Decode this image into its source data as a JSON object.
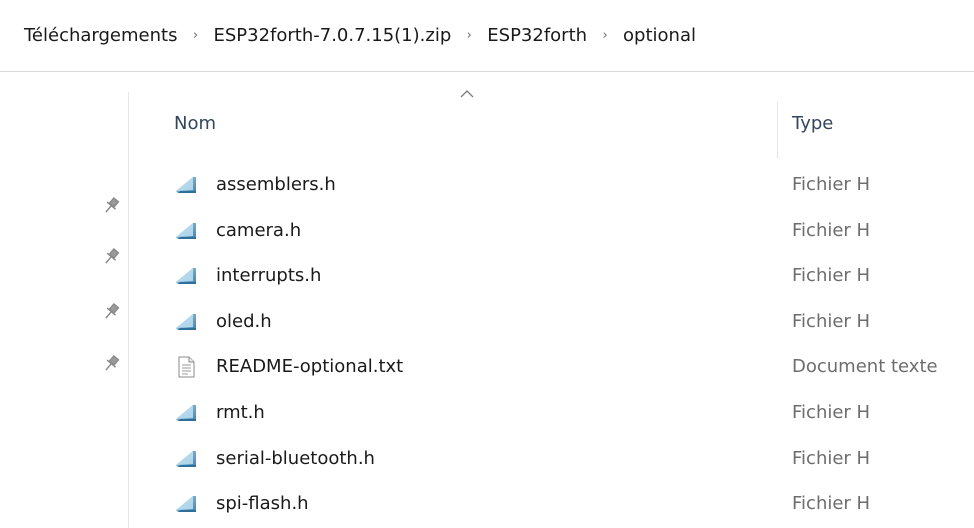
{
  "breadcrumb": [
    {
      "label": "Téléchargements"
    },
    {
      "label": "ESP32forth-7.0.7.15(1).zip"
    },
    {
      "label": "ESP32forth"
    },
    {
      "label": "optional"
    }
  ],
  "breadcrumb_separator": "›",
  "columns": {
    "name": "Nom",
    "type": "Type"
  },
  "sort": {
    "column": "name",
    "direction": "ascending"
  },
  "files": [
    {
      "name": "assemblers.h",
      "type": "Fichier H",
      "icon": "header-file-icon"
    },
    {
      "name": "camera.h",
      "type": "Fichier H",
      "icon": "header-file-icon"
    },
    {
      "name": "interrupts.h",
      "type": "Fichier H",
      "icon": "header-file-icon"
    },
    {
      "name": "oled.h",
      "type": "Fichier H",
      "icon": "header-file-icon"
    },
    {
      "name": "README-optional.txt",
      "type": "Document texte",
      "icon": "text-file-icon"
    },
    {
      "name": "rmt.h",
      "type": "Fichier H",
      "icon": "header-file-icon"
    },
    {
      "name": "serial-bluetooth.h",
      "type": "Fichier H",
      "icon": "header-file-icon"
    },
    {
      "name": "spi-flash.h",
      "type": "Fichier H",
      "icon": "header-file-icon"
    }
  ],
  "quick_access_pins": [
    "pin-icon",
    "pin-icon",
    "pin-icon",
    "pin-icon"
  ],
  "colors": {
    "header_text": "#33475c",
    "secondary_text": "#6d6d6d",
    "divider": "#e5e5e5"
  }
}
